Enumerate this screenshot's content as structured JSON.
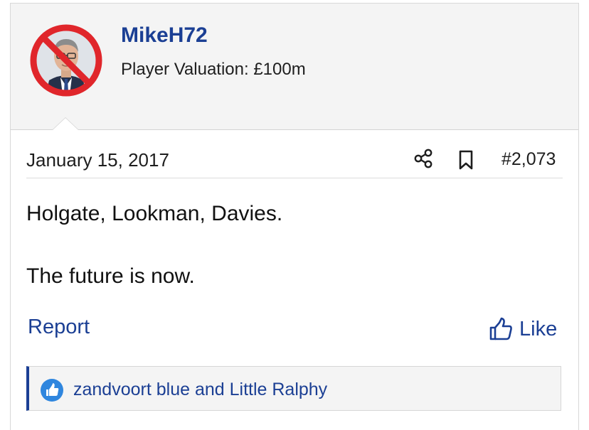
{
  "post": {
    "author": {
      "username": "MikeH72",
      "title": "Player Valuation: £100m",
      "avatar_icon": "no-symbol-over-portrait"
    },
    "date": "January 15, 2017",
    "post_number": "#2,073",
    "body_lines": [
      "Holgate, Lookman, Davies.",
      "The future is now."
    ],
    "actions": {
      "report_label": "Report",
      "like_label": "Like",
      "share_icon": "share-icon",
      "bookmark_icon": "bookmark-icon",
      "like_icon": "thumbs-up-icon"
    },
    "reactions": {
      "text": "zandvoort blue and Little Ralphy",
      "badge_icon": "thumbs-up-badge"
    }
  },
  "colors": {
    "accent": "#1b3f94",
    "header_bg": "#f4f4f4",
    "prohibit_red": "#e0262b",
    "reaction_badge": "#2f86de"
  }
}
